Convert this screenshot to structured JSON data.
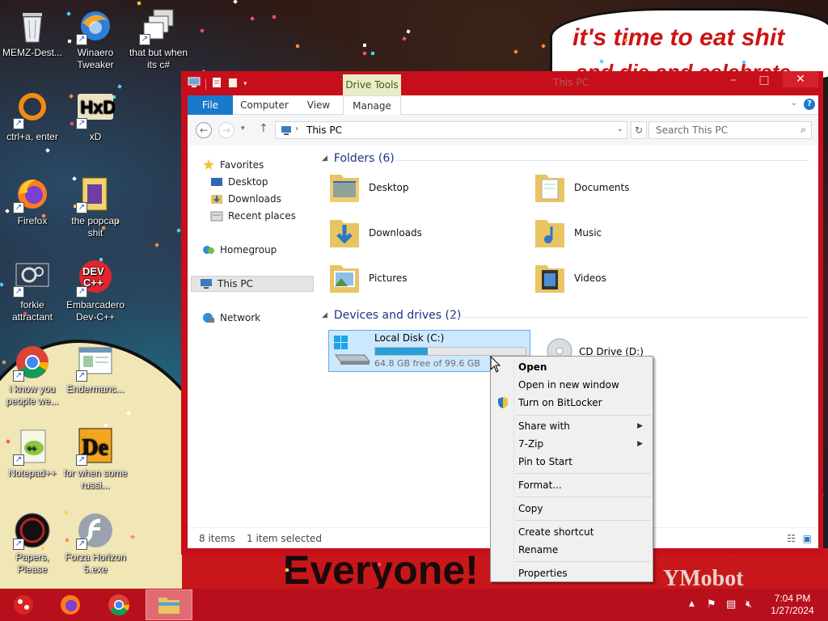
{
  "wallpaper": {
    "speech_line1": "it's time to eat shit",
    "speech_line2": "and die and celebrate",
    "banner": "Everyone!",
    "corner": "YMobot"
  },
  "desktop_icons": [
    {
      "label": "MEMZ-Dest...",
      "icon": "recycle-bin-icon",
      "shortcut": false
    },
    {
      "label": "Winaero Tweaker",
      "icon": "winaero-icon",
      "shortcut": true
    },
    {
      "label": "that but when its c#",
      "icon": "stacked-windows-icon",
      "shortcut": true
    },
    {
      "label": "ctrl+a, enter",
      "icon": "orange-ring-icon",
      "shortcut": true
    },
    {
      "label": "xD",
      "icon": "hxd-icon",
      "shortcut": true
    },
    {
      "label": "Firefox",
      "icon": "firefox-icon",
      "shortcut": true
    },
    {
      "label": "the popcap shit",
      "icon": "popcap-icon",
      "shortcut": true
    },
    {
      "label": "forkie attractant",
      "icon": "gear-monitor-icon",
      "shortcut": true
    },
    {
      "label": "Embarcadero Dev-C++",
      "icon": "devcpp-icon",
      "shortcut": true
    },
    {
      "label": "i know you people we...",
      "icon": "chrome-icon",
      "shortcut": true
    },
    {
      "label": "Endermanc...",
      "icon": "window-app-icon",
      "shortcut": true
    },
    {
      "label": "Notepad++",
      "icon": "notepadpp-icon",
      "shortcut": true
    },
    {
      "label": "for when some russi...",
      "icon": "de-icon",
      "shortcut": true
    },
    {
      "label": "Papers, Please",
      "icon": "papers-please-icon",
      "shortcut": true
    },
    {
      "label": "Forza Horizon 5.exe",
      "icon": "flash-icon",
      "shortcut": true
    }
  ],
  "window": {
    "title": "This PC",
    "contextual_tab": "Drive Tools",
    "tabs": [
      "File",
      "Computer",
      "View",
      "Manage"
    ],
    "address": "This PC",
    "search_placeholder": "Search This PC",
    "nav": {
      "favorites": "Favorites",
      "desktop": "Desktop",
      "downloads": "Downloads",
      "recent": "Recent places",
      "homegroup": "Homegroup",
      "this_pc": "This PC",
      "network": "Network"
    },
    "folders_header": "Folders (6)",
    "folders": [
      "Desktop",
      "Documents",
      "Downloads",
      "Music",
      "Pictures",
      "Videos"
    ],
    "devices_header": "Devices and drives (2)",
    "drive_c": {
      "name": "Local Disk (C:)",
      "free_text": "64.8 GB free of 99.6 GB",
      "used_fraction": 0.35
    },
    "drive_d": {
      "name": "CD Drive (D:)"
    },
    "status_items": "8 items",
    "status_selected": "1 item selected"
  },
  "context_menu": {
    "open": "Open",
    "open_new_window": "Open in new window",
    "bitlocker": "Turn on BitLocker",
    "share_with": "Share with",
    "zip": "7-Zip",
    "pin_start": "Pin to Start",
    "format": "Format...",
    "copy": "Copy",
    "create_shortcut": "Create shortcut",
    "rename": "Rename",
    "properties": "Properties"
  },
  "taskbar": {
    "time": "7:04 PM",
    "date": "1/27/2024"
  },
  "colors": {
    "window_frame": "#c70f1b",
    "taskbar": "#b80f1c",
    "file_tab": "#1979ca",
    "selection": "#cce8ff",
    "drive_bar": "#26a0da",
    "header_text": "#1e3287"
  }
}
